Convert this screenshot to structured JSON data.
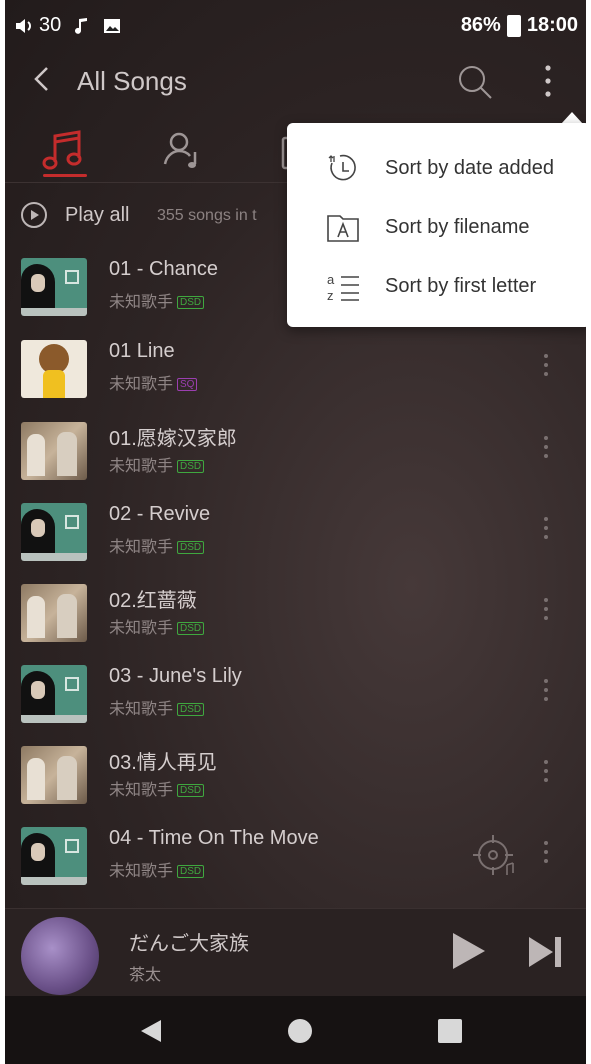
{
  "status_bar": {
    "volume": "30",
    "battery": "86%",
    "time": "18:00"
  },
  "header": {
    "title": "All Songs"
  },
  "tabs": [
    {
      "icon": "music-note-icon",
      "active": true
    },
    {
      "icon": "artist-icon",
      "active": false
    },
    {
      "icon": "album-icon",
      "active": false
    }
  ],
  "play_all": {
    "label": "Play all",
    "count": "355 songs in t"
  },
  "songs": [
    {
      "title": "01 - Chance",
      "artist": "未知歌手",
      "badge": "DSD"
    },
    {
      "title": "01 Line",
      "artist": "未知歌手",
      "badge": "SQ"
    },
    {
      "title": "01.愿嫁汉家郎",
      "artist": "未知歌手",
      "badge": "DSD"
    },
    {
      "title": "02 - Revive",
      "artist": "未知歌手",
      "badge": "DSD"
    },
    {
      "title": "02.红蔷薇",
      "artist": "未知歌手",
      "badge": "DSD"
    },
    {
      "title": "03 - June's Lily",
      "artist": "未知歌手",
      "badge": "DSD"
    },
    {
      "title": "03.情人再见",
      "artist": "未知歌手",
      "badge": "DSD"
    },
    {
      "title": "04 - Time On The Move",
      "artist": "未知歌手",
      "badge": "DSD"
    }
  ],
  "now_playing": {
    "title": "だんご大家族",
    "artist": "茶太"
  },
  "sort_menu": {
    "items": [
      {
        "label": "Sort by date added",
        "icon": "clock-sort-icon"
      },
      {
        "label": "Sort by filename",
        "icon": "file-a-icon"
      },
      {
        "label": "Sort by first letter",
        "icon": "az-sort-icon"
      }
    ]
  },
  "colors": {
    "accent": "#c42c2c",
    "dsd": "#3fa83f",
    "sq": "#9b3fb0",
    "background": "#2d2424"
  }
}
